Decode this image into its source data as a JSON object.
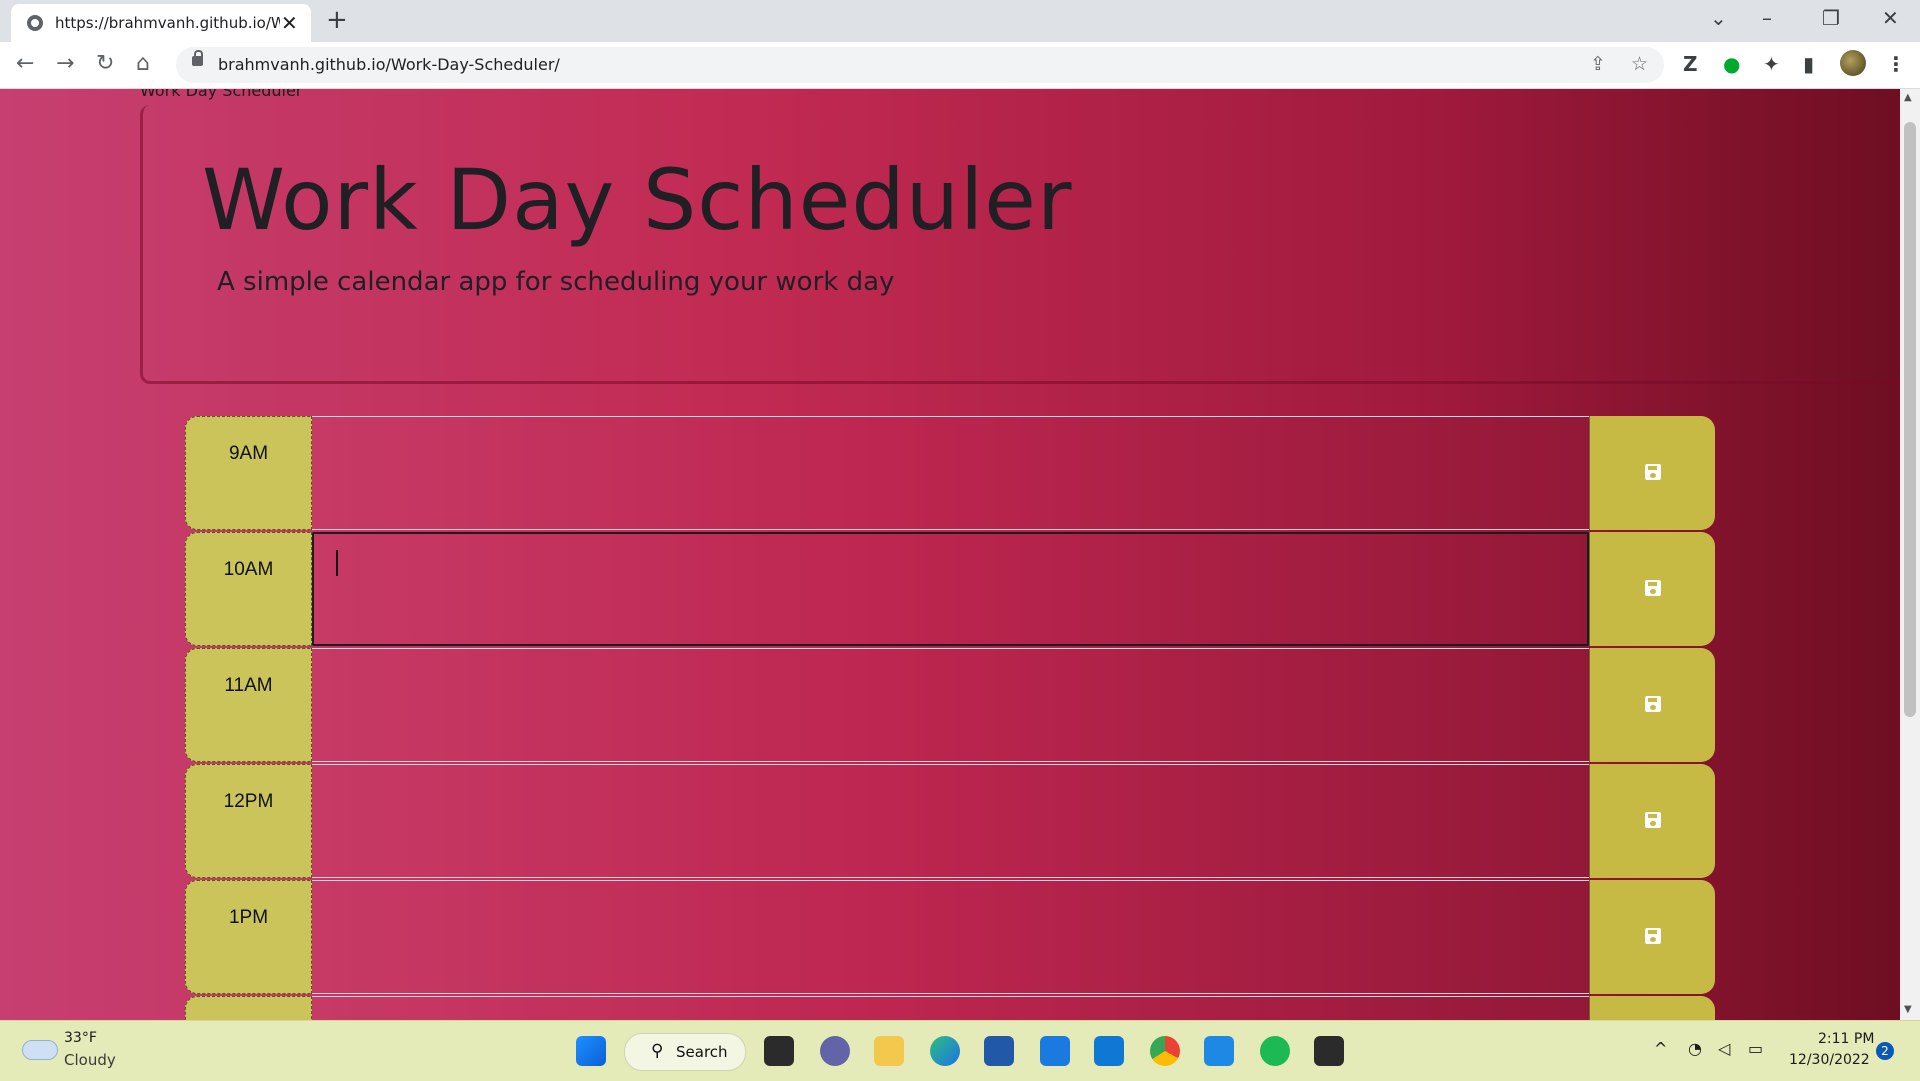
{
  "browser": {
    "tab_title": "https://brahmvanh.github.io/Work-Day-Scheduler/",
    "tab_close": "✕",
    "new_tab": "+",
    "url": "brahmvanh.github.io/Work-Day-Scheduler/"
  },
  "page": {
    "cut_title": "Work Day Scheduler",
    "title": "Work Day Scheduler",
    "subtitle": "A simple calendar app for scheduling your work day",
    "colors": {
      "hour_block": "#cbc45a",
      "save_button": "#c6ba45",
      "background_start": "#c63f70",
      "background_end": "#6e0e22"
    },
    "rows": [
      {
        "hour": "9AM",
        "text": ""
      },
      {
        "hour": "10AM",
        "text": ""
      },
      {
        "hour": "11AM",
        "text": ""
      },
      {
        "hour": "12PM",
        "text": ""
      },
      {
        "hour": "1PM",
        "text": ""
      },
      {
        "hour": "",
        "text": ""
      }
    ],
    "focused_row": "10AM"
  },
  "taskbar": {
    "weather_temp": "33°F",
    "weather_condition": "Cloudy",
    "search_label": "Search",
    "time": "2:11 PM",
    "date": "12/30/2022",
    "notification_count": "2"
  }
}
